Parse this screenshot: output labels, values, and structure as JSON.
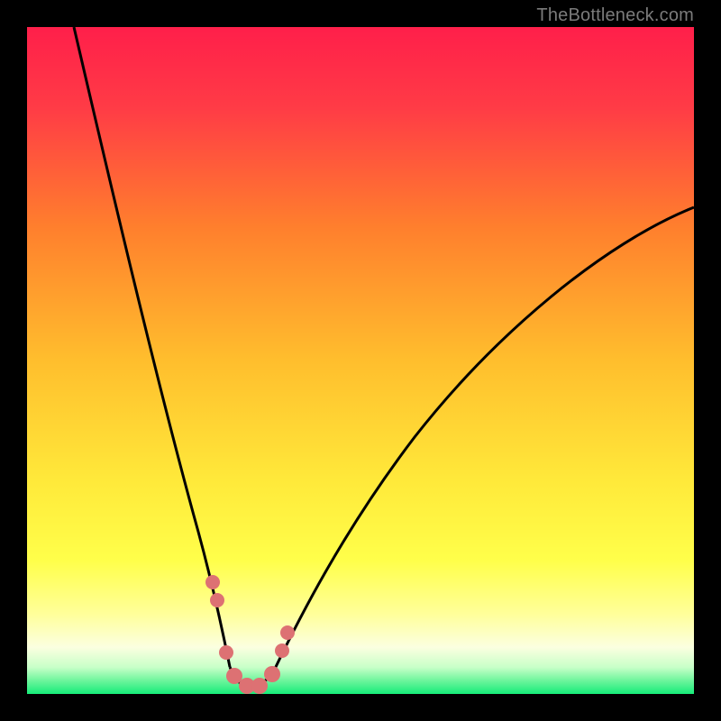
{
  "watermark": "TheBottleneck.com",
  "colors": {
    "frame": "#000000",
    "watermark": "#7b7b7b",
    "curve": "#000000",
    "marker": "#dd7173",
    "gradient_top": "#ff1f4a",
    "gradient_mid_upper": "#ff8a2a",
    "gradient_mid": "#ffe13a",
    "gradient_low": "#ffff70",
    "gradient_lower": "#f9ffd0",
    "gradient_bottom": "#16ec79"
  },
  "chart_data": {
    "type": "line",
    "title": "",
    "xlabel": "",
    "ylabel": "",
    "xlim": [
      0,
      100
    ],
    "ylim": [
      0,
      100
    ],
    "grid": false,
    "legend": "none",
    "series": [
      {
        "name": "bottleneck-curve",
        "x": [
          7,
          10,
          15,
          20,
          25,
          27,
          29,
          31,
          33,
          35,
          37,
          42,
          50,
          60,
          70,
          80,
          90,
          100
        ],
        "values": [
          100,
          90,
          72,
          54,
          34,
          23,
          12,
          3,
          1,
          1,
          3,
          11,
          23,
          36,
          48,
          58,
          66,
          72
        ]
      }
    ],
    "markers": {
      "name": "highlighted-points",
      "x": [
        27,
        27.5,
        29.5,
        31,
        33,
        35,
        37,
        38
      ],
      "values": [
        23,
        18,
        7,
        3,
        1,
        1,
        3,
        7
      ]
    }
  }
}
